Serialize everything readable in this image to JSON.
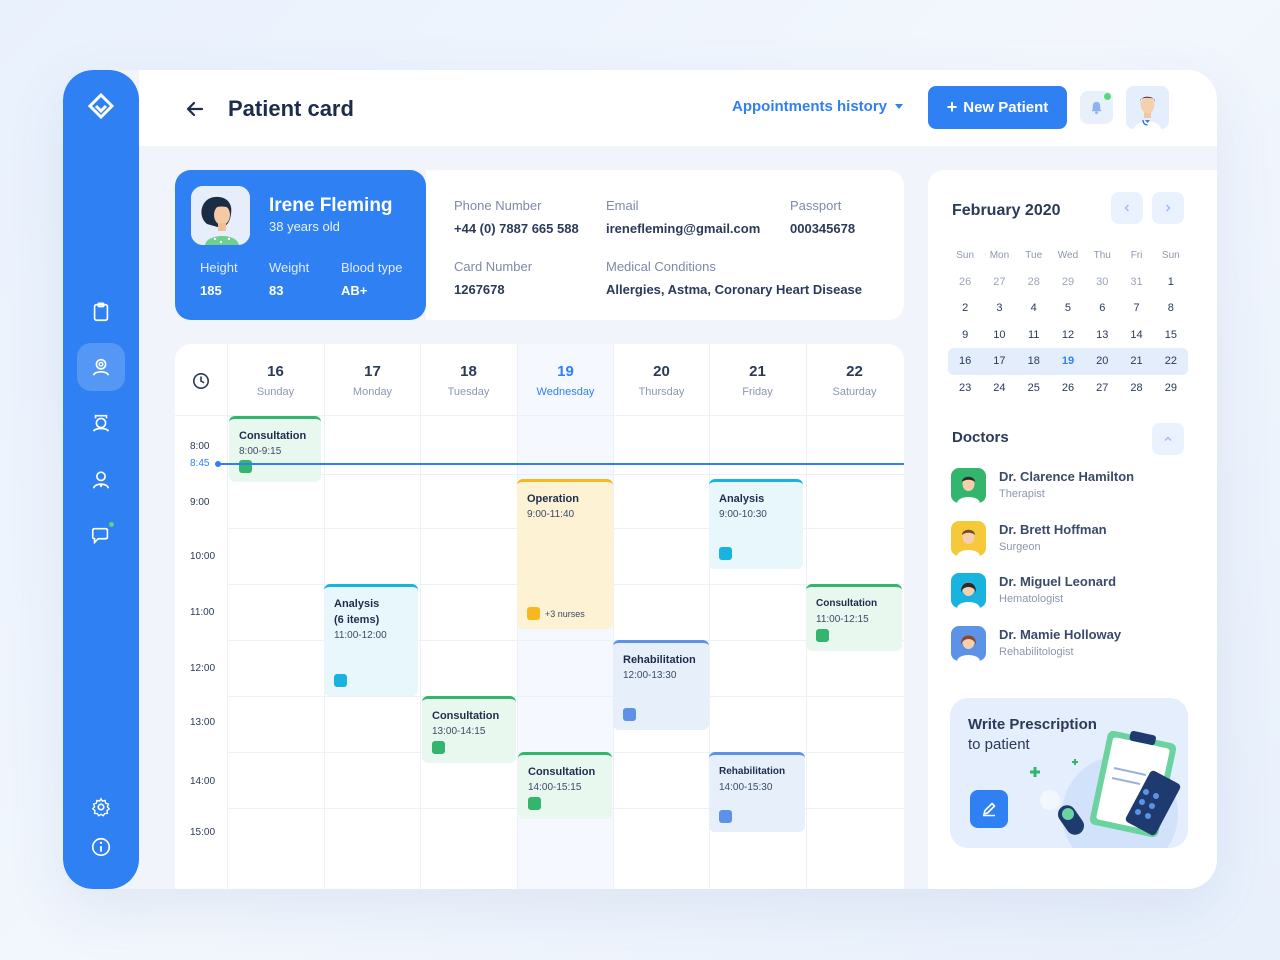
{
  "header": {
    "title": "Patient card",
    "appointments_history": "Appointments history",
    "new_patient": "New Patient",
    "new_patient_plus": "+"
  },
  "patient": {
    "name": "Irene Fleming",
    "age": "38 years old",
    "height_label": "Height",
    "height": "185",
    "weight_label": "Weight",
    "weight": "83",
    "blood_label": "Blood type",
    "blood": "AB+",
    "phone_label": "Phone Number",
    "phone": "+44 (0) 7887 665 588",
    "email_label": "Email",
    "email": "irenefleming@gmail.com",
    "passport_label": "Passport",
    "passport": "000345678",
    "card_label": "Card Number",
    "card": "1267678",
    "conditions_label": "Medical Conditions",
    "conditions": "Allergies, Astma, Coronary Heart Disease"
  },
  "schedule": {
    "days": [
      {
        "num": "16",
        "name": "Sunday"
      },
      {
        "num": "17",
        "name": "Monday"
      },
      {
        "num": "18",
        "name": "Tuesday"
      },
      {
        "num": "19",
        "name": "Wednesday"
      },
      {
        "num": "20",
        "name": "Thursday"
      },
      {
        "num": "21",
        "name": "Friday"
      },
      {
        "num": "22",
        "name": "Saturday"
      }
    ],
    "times": [
      "8:00",
      "9:00",
      "10:00",
      "11:00",
      "12:00",
      "13:00",
      "14:00",
      "15:00"
    ],
    "now": "8:45",
    "events": [
      {
        "title": "Consultation",
        "time": "8:00-9:15",
        "extra": ""
      },
      {
        "title": "Operation",
        "time": "9:00-11:40",
        "extra": "+3 nurses"
      },
      {
        "title": "Analysis",
        "time": "9:00-10:30",
        "extra": ""
      },
      {
        "title": "Analysis\n(6 items)",
        "time": "11:00-12:00",
        "extra": ""
      },
      {
        "title": "Consultation",
        "time": "11:00-12:15",
        "extra": ""
      },
      {
        "title": "Rehabilitation",
        "time": "12:00-13:30",
        "extra": ""
      },
      {
        "title": "Consultation",
        "time": "13:00-14:15",
        "extra": ""
      },
      {
        "title": "Consultation",
        "time": "14:00-15:15",
        "extra": ""
      },
      {
        "title": "Rehabilitation",
        "time": "14:00-15:30",
        "extra": ""
      }
    ]
  },
  "calendar": {
    "month": "February 2020",
    "weekdays": [
      "Sun",
      "Mon",
      "Tue",
      "Wed",
      "Thu",
      "Fri",
      "Sun"
    ],
    "weeks": [
      [
        "26",
        "27",
        "28",
        "29",
        "30",
        "31",
        "1"
      ],
      [
        "2",
        "3",
        "4",
        "5",
        "6",
        "7",
        "8"
      ],
      [
        "9",
        "10",
        "11",
        "12",
        "13",
        "14",
        "15"
      ],
      [
        "16",
        "17",
        "18",
        "19",
        "20",
        "21",
        "22"
      ],
      [
        "23",
        "24",
        "25",
        "26",
        "27",
        "28",
        "29"
      ]
    ],
    "today": "19"
  },
  "doctors": {
    "title": "Doctors",
    "list": [
      {
        "name": "Dr. Clarence Hamilton",
        "role": "Therapist"
      },
      {
        "name": "Dr. Brett Hoffman",
        "role": "Surgeon"
      },
      {
        "name": "Dr. Miguel Leonard",
        "role": "Hematologist"
      },
      {
        "name": "Dr. Mamie Holloway",
        "role": "Rehabilitologist"
      }
    ]
  },
  "prescription": {
    "title": "Write Prescription",
    "subtitle": "to patient"
  },
  "colors": {
    "accent": "#2f80f2",
    "green": "#34b56e",
    "cyan": "#19b3e0",
    "yellow": "#f5b81d",
    "blue": "#5c93e6"
  }
}
